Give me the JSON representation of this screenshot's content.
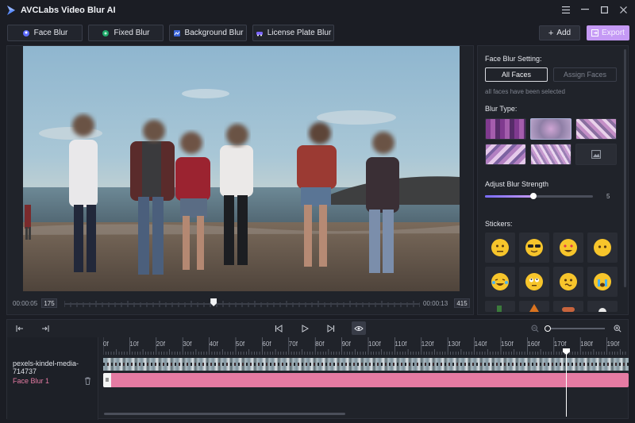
{
  "app": {
    "title": "AVCLabs Video Blur AI"
  },
  "window": {
    "icons": [
      "menu-icon",
      "minimize-icon",
      "maximize-icon",
      "close-icon"
    ]
  },
  "modes": [
    {
      "label": "Face Blur",
      "icon": "face-icon"
    },
    {
      "label": "Fixed Blur",
      "icon": "fixed-icon"
    },
    {
      "label": "Background Blur",
      "icon": "background-icon"
    },
    {
      "label": "License Plate Blur",
      "icon": "car-icon"
    }
  ],
  "actions": {
    "add_label": "Add",
    "export_label": "Export"
  },
  "preview": {
    "current_time": "00:00:05",
    "current_frame": "175",
    "end_time": "00:00:13",
    "end_frame": "415",
    "progress": 0.42
  },
  "settings": {
    "heading": "Face Blur Setting:",
    "all_faces_label": "All Faces",
    "assign_faces_label": "Assign Faces",
    "note": "all faces have been selected",
    "blur_type_label": "Blur Type:",
    "strength_label": "Adjust Blur Strength",
    "strength_value": "5",
    "strength_fraction": 0.45,
    "stickers_label": "Stickers:"
  },
  "timeline": {
    "ruler": [
      "0f",
      "10f",
      "20f",
      "30f",
      "40f",
      "50f",
      "60f",
      "70f",
      "80f",
      "90f",
      "100f",
      "110f",
      "120f",
      "130f",
      "140f",
      "150f",
      "160f",
      "170f",
      "180f",
      "190f"
    ],
    "video_track": "pexels-kindel-media-714737",
    "blur_track": "Face Blur 1",
    "zoom": 0.05
  },
  "colors": {
    "accent": "#c59af5",
    "blur_track": "#e57ba3",
    "track_label": "#e57ba3"
  }
}
